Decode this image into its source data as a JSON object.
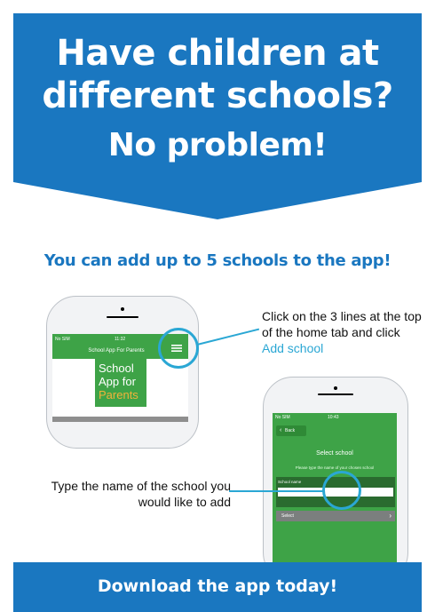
{
  "colors": {
    "brand_blue": "#1a77c0",
    "accent_cyan": "#2aa7d4",
    "app_green": "#3ea347",
    "logo_orange": "#f0b23a"
  },
  "banner": {
    "line1": "Have children at",
    "line2": "different schools?",
    "line3": "No problem!"
  },
  "subheading": "You can add up to 5 schools to the app!",
  "phone1": {
    "carrier": "No SIM",
    "time": "11:32",
    "nav_title": "School App For Parents",
    "menu_icon": "menu-icon",
    "logo": {
      "line1": "School",
      "line2": "App for",
      "line3": "Parents"
    }
  },
  "callout1": {
    "text": "Click on the 3 lines at the top of the home tab and click ",
    "link": "Add school"
  },
  "phone2": {
    "carrier": "No SIM",
    "time": "10:43",
    "back_label": "Back",
    "title": "Select school",
    "hint": "Please type the name of your chosen school",
    "field_label": "School name",
    "select_label": "Select"
  },
  "callout2": {
    "text": "Type the name of the school you would like to add"
  },
  "footer": {
    "text": "Download the app today!"
  }
}
